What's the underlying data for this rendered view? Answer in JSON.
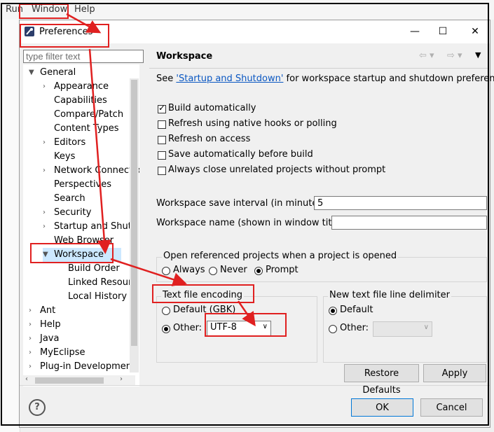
{
  "menubar": {
    "items": [
      "Run",
      "Window",
      "Help"
    ]
  },
  "dialog": {
    "title": "Preferences",
    "minimize": "—",
    "maximize": "☐",
    "close": "✕"
  },
  "filter": {
    "placeholder": "type filter text"
  },
  "tree": {
    "general": "General",
    "children": [
      "Appearance",
      "Capabilities",
      "Compare/Patch",
      "Content Types",
      "Editors",
      "Keys",
      "Network Connectio",
      "Perspectives",
      "Search",
      "Security",
      "Startup and Shutd",
      "Web Browser"
    ],
    "workspace": "Workspace",
    "workspace_children": [
      "Build Order",
      "Linked Resourc",
      "Local History"
    ],
    "roots": [
      "Ant",
      "Help",
      "Java",
      "MyEclipse",
      "Plug-in Development"
    ]
  },
  "page": {
    "title": "Workspace",
    "see_prefix": "See ",
    "see_link": "'Startup and Shutdown'",
    "see_suffix": " for workspace startup and shutdown preferences.",
    "checkboxes": [
      {
        "label": "Build automatically",
        "checked": true
      },
      {
        "label": "Refresh using native hooks or polling",
        "checked": false
      },
      {
        "label": "Refresh on access",
        "checked": false
      },
      {
        "label": "Save automatically before build",
        "checked": false
      },
      {
        "label": "Always close unrelated projects without prompt",
        "checked": false
      }
    ],
    "save_interval_label": "Workspace save interval (in minutes):",
    "save_interval_value": "5",
    "workspace_name_label": "Workspace name (shown in window title):",
    "workspace_name_value": "",
    "open_ref_title": "Open referenced projects when a project is opened",
    "open_ref_options": [
      "Always",
      "Never",
      "Prompt"
    ],
    "open_ref_selected": "Prompt",
    "encoding_title": "Text file encoding",
    "encoding_default": "Default (GBK)",
    "encoding_other": "Other:",
    "encoding_value": "UTF-8",
    "delim_title": "New text file line delimiter",
    "delim_default": "Default",
    "delim_other": "Other:",
    "restore_defaults": "Restore Defaults",
    "apply": "Apply"
  },
  "footer": {
    "help": "?",
    "ok": "OK",
    "cancel": "Cancel"
  },
  "colors": {
    "annotation": "#e02020",
    "link": "#0a57c2"
  }
}
